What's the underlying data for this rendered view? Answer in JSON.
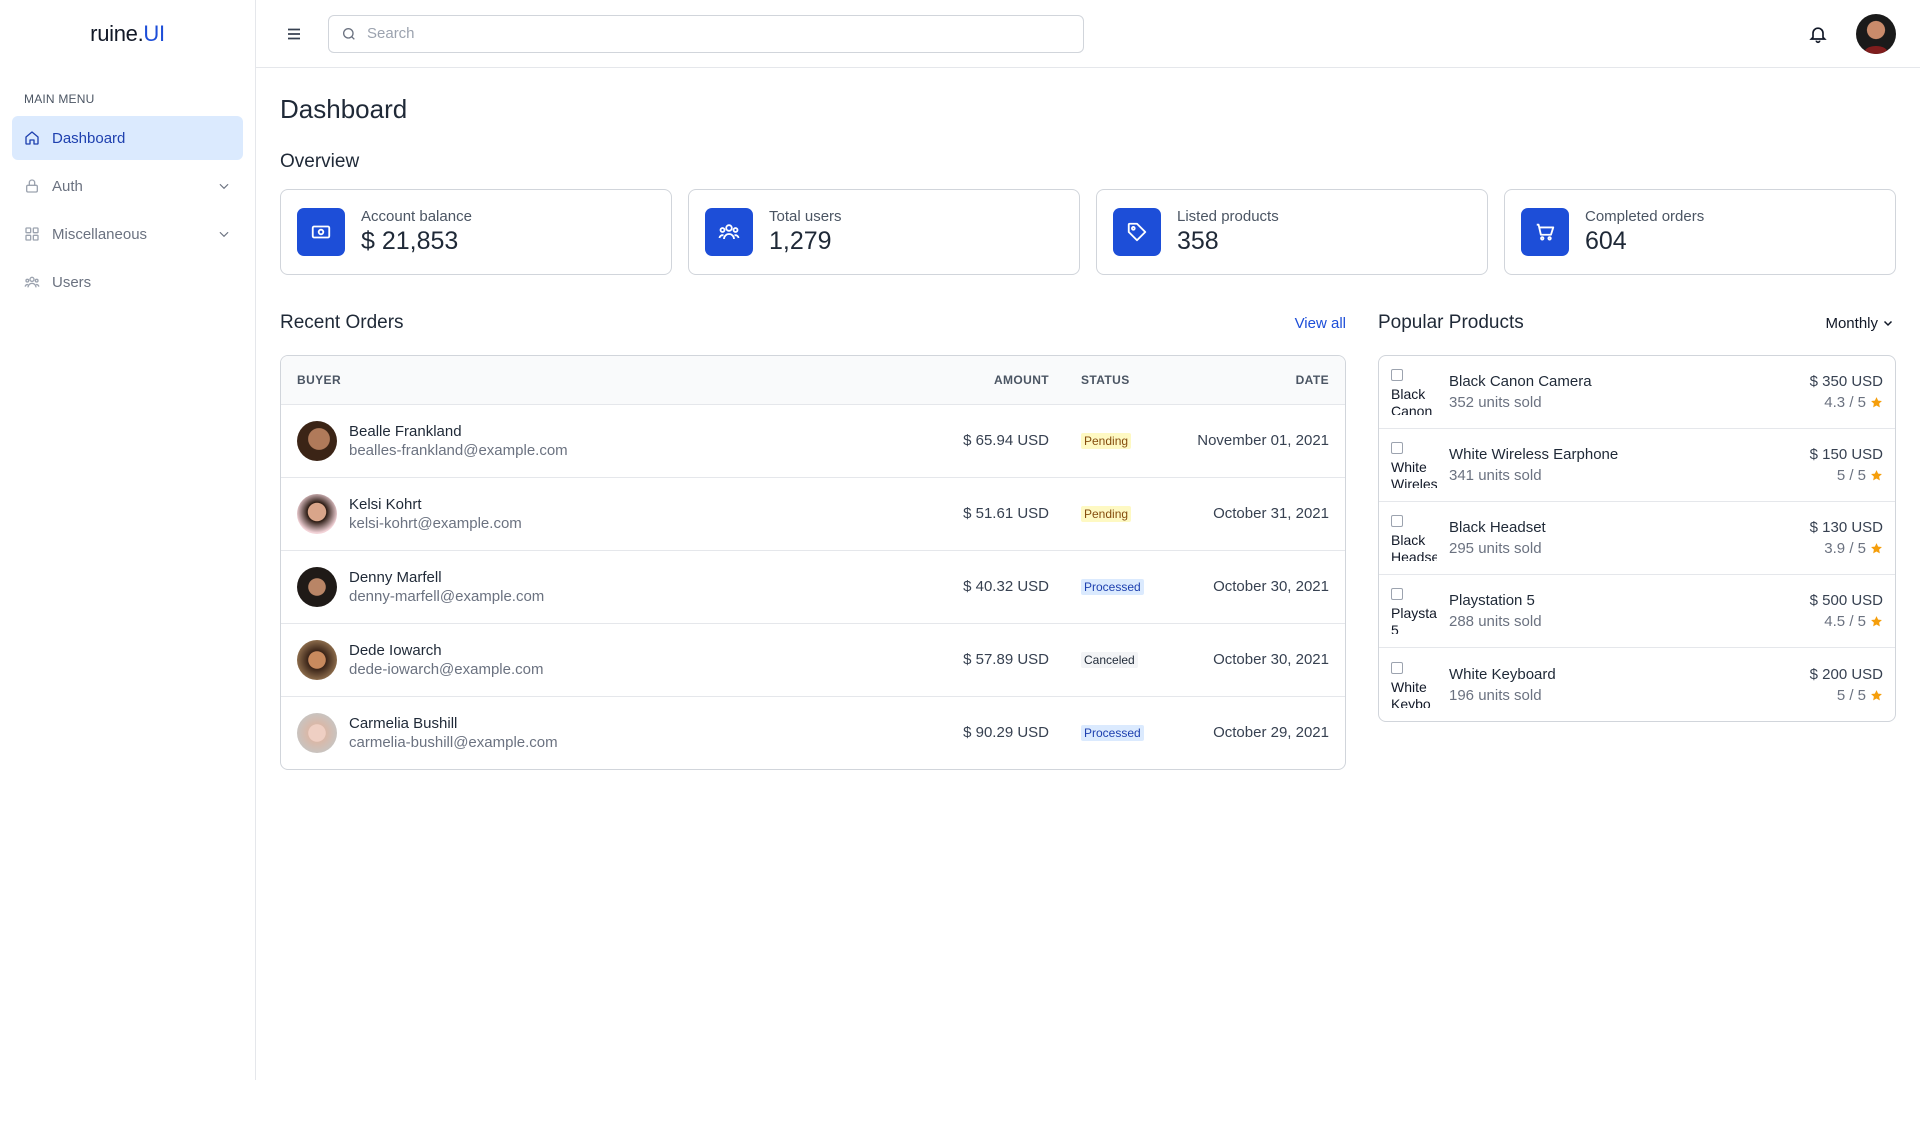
{
  "brand": {
    "part1": "ruine.",
    "part2": "UI"
  },
  "sidebar": {
    "heading": "MAIN MENU",
    "items": [
      {
        "label": "Dashboard",
        "icon": "home-icon",
        "active": true
      },
      {
        "label": "Auth",
        "icon": "lock-icon",
        "expandable": true
      },
      {
        "label": "Miscellaneous",
        "icon": "grid-icon",
        "expandable": true
      },
      {
        "label": "Users",
        "icon": "users-icon"
      }
    ]
  },
  "topbar": {
    "search_placeholder": "Search"
  },
  "page": {
    "title": "Dashboard",
    "overview_title": "Overview"
  },
  "stats": [
    {
      "label": "Account balance",
      "value": "$ 21,853",
      "icon": "money-icon"
    },
    {
      "label": "Total users",
      "value": "1,279",
      "icon": "users-icon"
    },
    {
      "label": "Listed products",
      "value": "358",
      "icon": "tag-icon"
    },
    {
      "label": "Completed orders",
      "value": "604",
      "icon": "cart-icon"
    }
  ],
  "orders": {
    "title": "Recent Orders",
    "view_all": "View all",
    "columns": {
      "buyer": "BUYER",
      "amount": "AMOUNT",
      "status": "STATUS",
      "date": "DATE"
    },
    "rows": [
      {
        "name": "Bealle Frankland",
        "email": "bealles-frankland@example.com",
        "amount": "$ 65.94 USD",
        "status": "Pending",
        "status_kind": "pending",
        "date": "November 01, 2021"
      },
      {
        "name": "Kelsi Kohrt",
        "email": "kelsi-kohrt@example.com",
        "amount": "$ 51.61 USD",
        "status": "Pending",
        "status_kind": "pending",
        "date": "October 31, 2021"
      },
      {
        "name": "Denny Marfell",
        "email": "denny-marfell@example.com",
        "amount": "$ 40.32 USD",
        "status": "Processed",
        "status_kind": "processed",
        "date": "October 30, 2021"
      },
      {
        "name": "Dede Iowarch",
        "email": "dede-iowarch@example.com",
        "amount": "$ 57.89 USD",
        "status": "Canceled",
        "status_kind": "canceled",
        "date": "October 30, 2021"
      },
      {
        "name": "Carmelia Bushill",
        "email": "carmelia-bushill@example.com",
        "amount": "$ 90.29 USD",
        "status": "Processed",
        "status_kind": "processed",
        "date": "October 29, 2021"
      }
    ]
  },
  "products": {
    "title": "Popular Products",
    "period": "Monthly",
    "rows": [
      {
        "alt": "Black Canon",
        "name": "Black Canon Camera",
        "sold": "352 units sold",
        "price": "$ 350 USD",
        "rating": "4.3 / 5"
      },
      {
        "alt": "White Wireles",
        "name": "White Wireless Earphone",
        "sold": "341 units sold",
        "price": "$ 150 USD",
        "rating": "5 / 5"
      },
      {
        "alt": "Black Headse",
        "name": "Black Headset",
        "sold": "295 units sold",
        "price": "$ 130 USD",
        "rating": "3.9 / 5"
      },
      {
        "alt": "Playsta 5",
        "name": "Playstation 5",
        "sold": "288 units sold",
        "price": "$ 500 USD",
        "rating": "4.5 / 5"
      },
      {
        "alt": "White Keybo",
        "name": "White Keyboard",
        "sold": "196 units sold",
        "price": "$ 200 USD",
        "rating": "5 / 5"
      }
    ]
  },
  "colors": {
    "accent": "#1d4ed8",
    "active_bg": "#dbeafe",
    "star": "#f59e0b"
  }
}
